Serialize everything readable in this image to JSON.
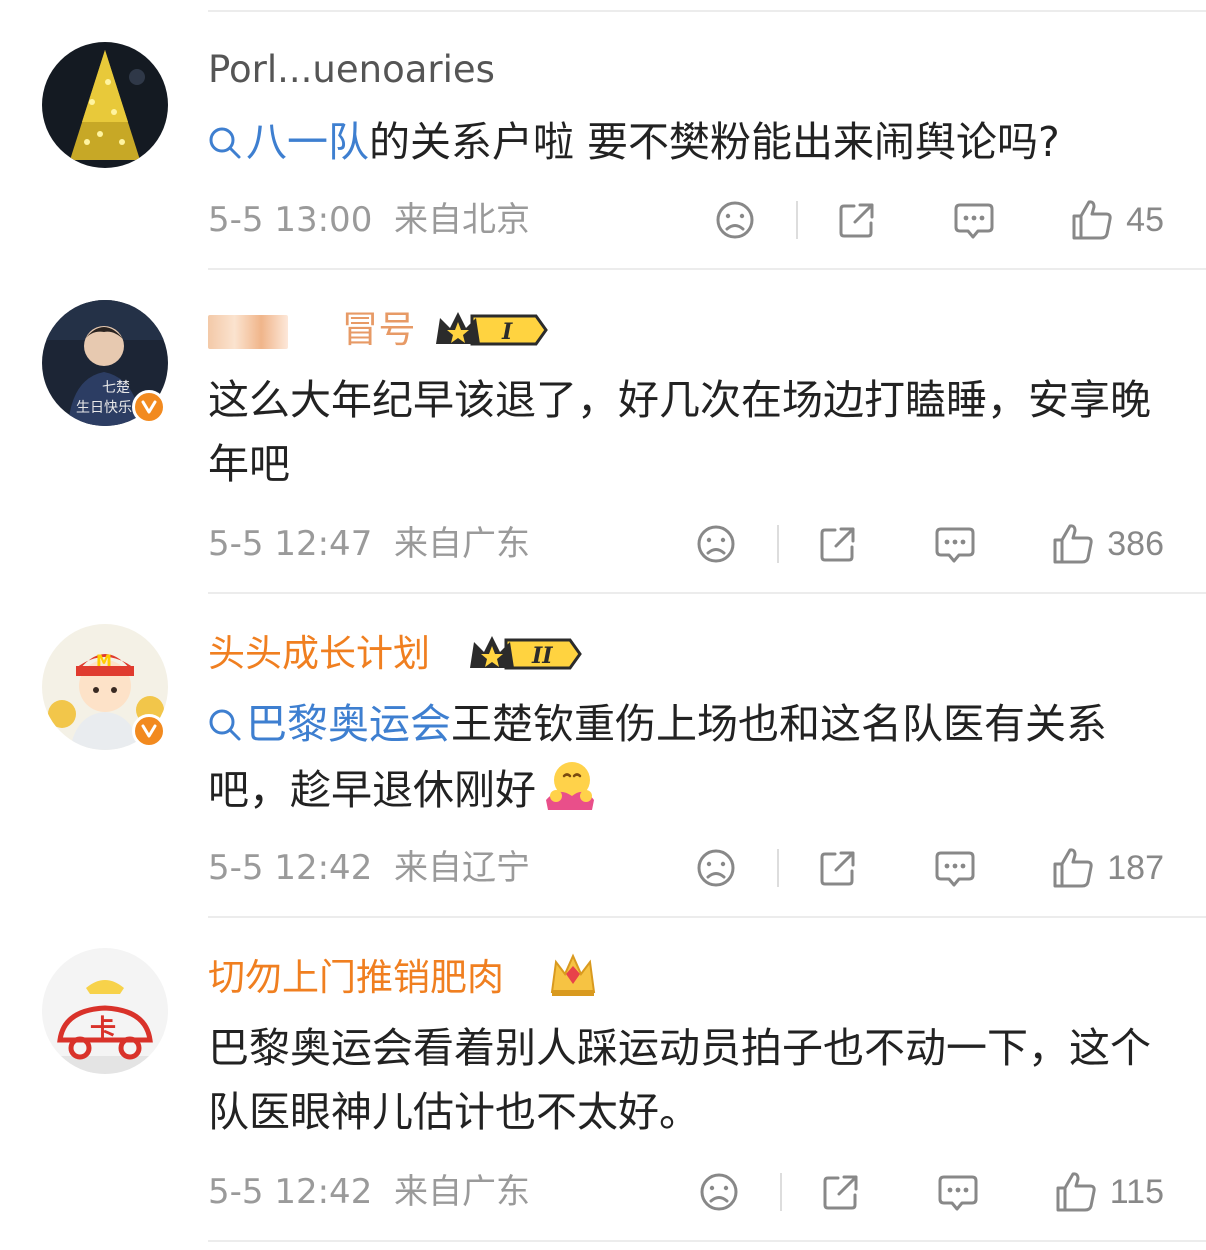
{
  "comments": [
    {
      "username": "Porl...uenoaries",
      "username_color": "#555555",
      "tag": "八一队",
      "text": "的关系户啦 要不樊粉能出来闹舆论吗?",
      "time": "5-5 13:00",
      "location": "来自北京",
      "likes": "45"
    },
    {
      "username": "冒号",
      "username_color": "#555555",
      "vip_level": "I",
      "text": "这么大年纪早该退了，好几次在场边打瞌睡，安享晚年吧",
      "time": "5-5 12:47",
      "location": "来自广东",
      "likes": "386"
    },
    {
      "username": "头头成长计划",
      "username_color": "#f07f20",
      "vip_level": "II",
      "tag": "巴黎奥运会",
      "text": "王楚钦重伤上场也和这名队医有关系吧，趁早退休刚好",
      "time": "5-5 12:42",
      "location": "来自辽宁",
      "likes": "187"
    },
    {
      "username": "切勿上门推销肥肉",
      "username_color": "#f07f20",
      "text": "巴黎奥运会看着别人踩运动员拍子也不动一下，这个队医眼神儿估计也不太好。",
      "time": "5-5 12:42",
      "location": "来自广东",
      "likes": "115"
    }
  ],
  "colors": {
    "tag": "#3e7fd0",
    "meta": "#9a9a9a",
    "vip_name": "#f07f20",
    "verified_badge": "#f28a1f"
  },
  "icons": [
    "search-icon",
    "dislike-icon",
    "share-icon",
    "comment-icon",
    "like-icon",
    "verified-badge-icon",
    "vip-crown-icon"
  ]
}
